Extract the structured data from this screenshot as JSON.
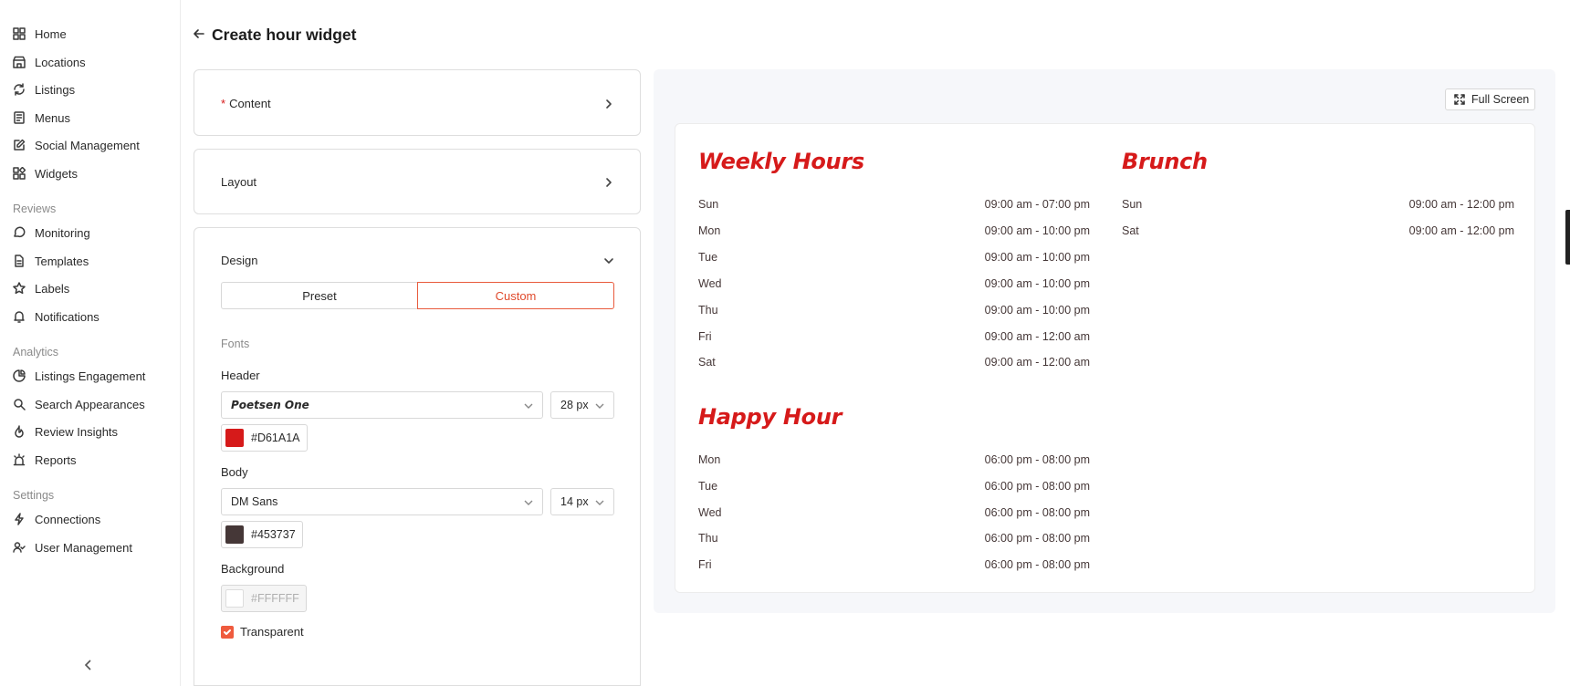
{
  "sidebar": {
    "main_items": [
      {
        "label": "Home",
        "icon": "grid-icon"
      },
      {
        "label": "Locations",
        "icon": "store-icon"
      },
      {
        "label": "Listings",
        "icon": "refresh-icon"
      },
      {
        "label": "Menus",
        "icon": "menu-book-icon"
      },
      {
        "label": "Social Management",
        "icon": "edit-icon"
      },
      {
        "label": "Widgets",
        "icon": "widgets-icon"
      }
    ],
    "reviews_section": "Reviews",
    "reviews_items": [
      {
        "label": "Monitoring",
        "icon": "chat-icon"
      },
      {
        "label": "Templates",
        "icon": "document-icon"
      },
      {
        "label": "Labels",
        "icon": "star-icon"
      },
      {
        "label": "Notifications",
        "icon": "bell-icon"
      }
    ],
    "analytics_section": "Analytics",
    "analytics_items": [
      {
        "label": "Listings Engagement",
        "icon": "pie-chart-icon"
      },
      {
        "label": "Search Appearances",
        "icon": "search-icon"
      },
      {
        "label": "Review Insights",
        "icon": "flame-icon"
      },
      {
        "label": "Reports",
        "icon": "alarm-icon"
      }
    ],
    "settings_section": "Settings",
    "settings_items": [
      {
        "label": "Connections",
        "icon": "bolt-icon"
      },
      {
        "label": "User Management",
        "icon": "users-icon"
      }
    ]
  },
  "header": {
    "title": "Create hour widget"
  },
  "panels": {
    "content_label": "Content",
    "content_required_mark": "*",
    "layout_label": "Layout",
    "design_label": "Design",
    "preset_label": "Preset",
    "custom_label": "Custom",
    "fonts_label": "Fonts",
    "header_label": "Header",
    "header_font": "Poetsen One",
    "header_size": "28 px",
    "header_color": "#D61A1A",
    "body_label": "Body",
    "body_font": "DM Sans",
    "body_size": "14 px",
    "body_color": "#453737",
    "background_label": "Background",
    "background_color": "#FFFFFF",
    "transparent_label": "Transparent",
    "transparent_checked": true
  },
  "preview": {
    "fullscreen_label": "Full Screen",
    "weekly": {
      "title": "Weekly Hours",
      "rows": [
        {
          "day": "Sun",
          "time": "09:00 am - 07:00 pm"
        },
        {
          "day": "Mon",
          "time": "09:00 am - 10:00 pm"
        },
        {
          "day": "Tue",
          "time": "09:00 am - 10:00 pm"
        },
        {
          "day": "Wed",
          "time": "09:00 am - 10:00 pm"
        },
        {
          "day": "Thu",
          "time": "09:00 am - 10:00 pm"
        },
        {
          "day": "Fri",
          "time": "09:00 am - 12:00 am"
        },
        {
          "day": "Sat",
          "time": "09:00 am - 12:00 am"
        }
      ]
    },
    "brunch": {
      "title": "Brunch",
      "rows": [
        {
          "day": "Sun",
          "time": "09:00 am - 12:00 pm"
        },
        {
          "day": "Sat",
          "time": "09:00 am - 12:00 pm"
        }
      ]
    },
    "happy_hour": {
      "title": "Happy Hour",
      "rows": [
        {
          "day": "Mon",
          "time": "06:00 pm - 08:00 pm"
        },
        {
          "day": "Tue",
          "time": "06:00 pm - 08:00 pm"
        },
        {
          "day": "Wed",
          "time": "06:00 pm - 08:00 pm"
        },
        {
          "day": "Thu",
          "time": "06:00 pm - 08:00 pm"
        },
        {
          "day": "Fri",
          "time": "06:00 pm - 08:00 pm"
        }
      ]
    }
  }
}
